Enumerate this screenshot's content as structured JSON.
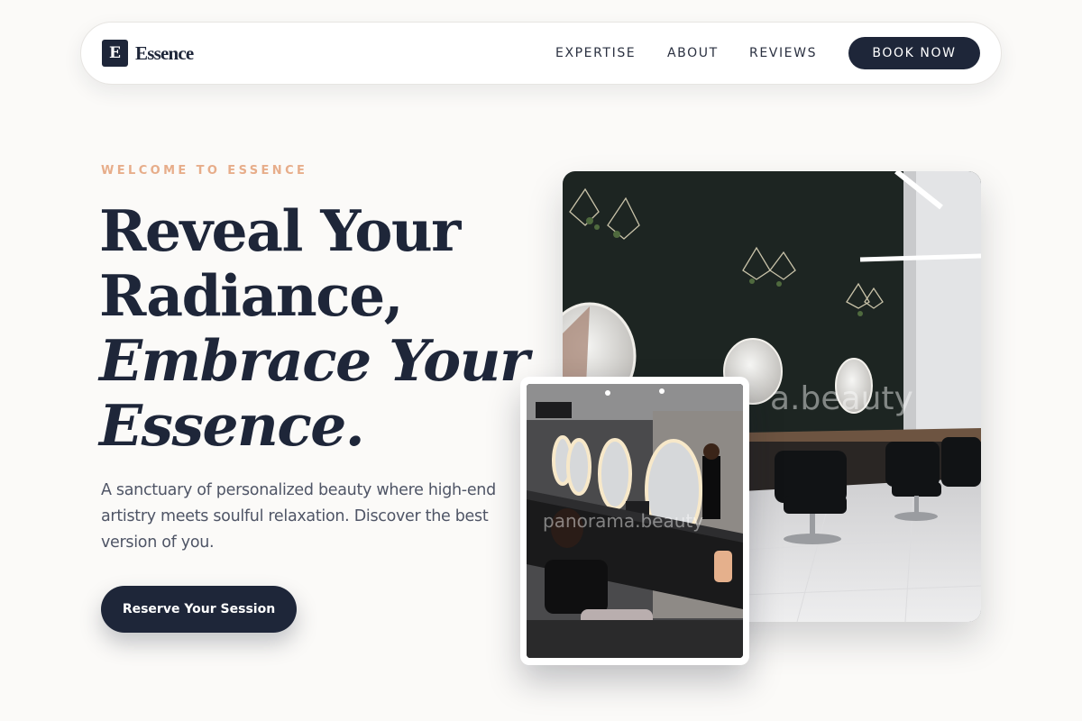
{
  "nav": {
    "logo_letter": "E",
    "logo_text": "Essence",
    "links": [
      {
        "label": "EXPERTISE"
      },
      {
        "label": "ABOUT"
      },
      {
        "label": "REVIEWS"
      }
    ],
    "cta_label": "BOOK NOW"
  },
  "hero": {
    "eyebrow": "WELCOME TO ESSENCE",
    "headline": {
      "line1": "Reveal Your",
      "line2": "Radiance,",
      "line3": "Embrace Your",
      "line4": "Essence."
    },
    "lead": "A sanctuary of personalized beauty where high-end artistry meets soulful relaxation. Discover the best version of you.",
    "button_label": "Reserve Your Session"
  },
  "images": {
    "main_watermark": "a.beauty",
    "inset_watermark": "panorama.beauty"
  },
  "colors": {
    "navy": "#1e2639",
    "accent": "#e7ad8a",
    "background": "#fbfaf8"
  }
}
